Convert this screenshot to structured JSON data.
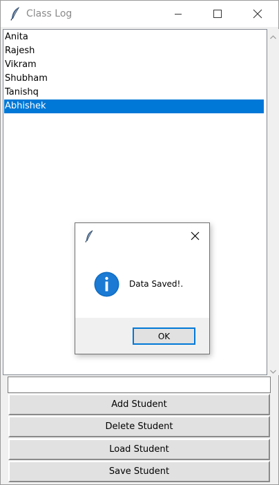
{
  "window": {
    "title": "Class Log",
    "icon": "feather-icon",
    "controls": [
      "minimize-icon",
      "maximize-icon",
      "close-icon"
    ]
  },
  "listbox": {
    "items": [
      "Anita",
      "Rajesh",
      "Vikram",
      "Shubham",
      "Tanishq",
      "Abhishek"
    ],
    "selected_index": 5,
    "selection_color": "#0078d7"
  },
  "entry": {
    "value": ""
  },
  "buttons": {
    "add": "Add Student",
    "delete": "Delete Student",
    "load": "Load Student",
    "save": "Save Student"
  },
  "dialog": {
    "icon": "info-icon",
    "message": "Data Saved!.",
    "ok_label": "OK",
    "accent_color": "#0078d7"
  }
}
